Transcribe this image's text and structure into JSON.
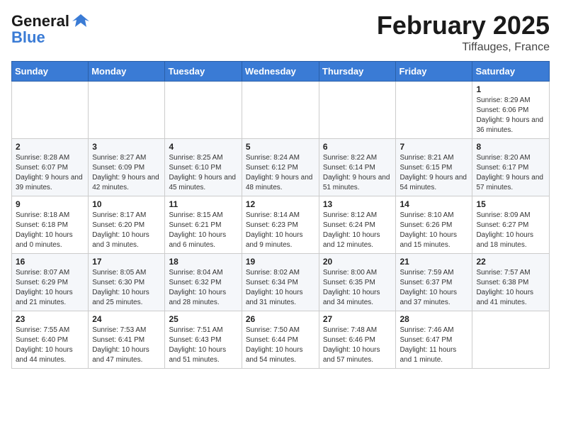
{
  "header": {
    "logo_line1": "General",
    "logo_line2": "Blue",
    "month_year": "February 2025",
    "location": "Tiffauges, France"
  },
  "weekdays": [
    "Sunday",
    "Monday",
    "Tuesday",
    "Wednesday",
    "Thursday",
    "Friday",
    "Saturday"
  ],
  "weeks": [
    [
      {
        "day": "",
        "info": ""
      },
      {
        "day": "",
        "info": ""
      },
      {
        "day": "",
        "info": ""
      },
      {
        "day": "",
        "info": ""
      },
      {
        "day": "",
        "info": ""
      },
      {
        "day": "",
        "info": ""
      },
      {
        "day": "1",
        "info": "Sunrise: 8:29 AM\nSunset: 6:06 PM\nDaylight: 9 hours and 36 minutes."
      }
    ],
    [
      {
        "day": "2",
        "info": "Sunrise: 8:28 AM\nSunset: 6:07 PM\nDaylight: 9 hours and 39 minutes."
      },
      {
        "day": "3",
        "info": "Sunrise: 8:27 AM\nSunset: 6:09 PM\nDaylight: 9 hours and 42 minutes."
      },
      {
        "day": "4",
        "info": "Sunrise: 8:25 AM\nSunset: 6:10 PM\nDaylight: 9 hours and 45 minutes."
      },
      {
        "day": "5",
        "info": "Sunrise: 8:24 AM\nSunset: 6:12 PM\nDaylight: 9 hours and 48 minutes."
      },
      {
        "day": "6",
        "info": "Sunrise: 8:22 AM\nSunset: 6:14 PM\nDaylight: 9 hours and 51 minutes."
      },
      {
        "day": "7",
        "info": "Sunrise: 8:21 AM\nSunset: 6:15 PM\nDaylight: 9 hours and 54 minutes."
      },
      {
        "day": "8",
        "info": "Sunrise: 8:20 AM\nSunset: 6:17 PM\nDaylight: 9 hours and 57 minutes."
      }
    ],
    [
      {
        "day": "9",
        "info": "Sunrise: 8:18 AM\nSunset: 6:18 PM\nDaylight: 10 hours and 0 minutes."
      },
      {
        "day": "10",
        "info": "Sunrise: 8:17 AM\nSunset: 6:20 PM\nDaylight: 10 hours and 3 minutes."
      },
      {
        "day": "11",
        "info": "Sunrise: 8:15 AM\nSunset: 6:21 PM\nDaylight: 10 hours and 6 minutes."
      },
      {
        "day": "12",
        "info": "Sunrise: 8:14 AM\nSunset: 6:23 PM\nDaylight: 10 hours and 9 minutes."
      },
      {
        "day": "13",
        "info": "Sunrise: 8:12 AM\nSunset: 6:24 PM\nDaylight: 10 hours and 12 minutes."
      },
      {
        "day": "14",
        "info": "Sunrise: 8:10 AM\nSunset: 6:26 PM\nDaylight: 10 hours and 15 minutes."
      },
      {
        "day": "15",
        "info": "Sunrise: 8:09 AM\nSunset: 6:27 PM\nDaylight: 10 hours and 18 minutes."
      }
    ],
    [
      {
        "day": "16",
        "info": "Sunrise: 8:07 AM\nSunset: 6:29 PM\nDaylight: 10 hours and 21 minutes."
      },
      {
        "day": "17",
        "info": "Sunrise: 8:05 AM\nSunset: 6:30 PM\nDaylight: 10 hours and 25 minutes."
      },
      {
        "day": "18",
        "info": "Sunrise: 8:04 AM\nSunset: 6:32 PM\nDaylight: 10 hours and 28 minutes."
      },
      {
        "day": "19",
        "info": "Sunrise: 8:02 AM\nSunset: 6:34 PM\nDaylight: 10 hours and 31 minutes."
      },
      {
        "day": "20",
        "info": "Sunrise: 8:00 AM\nSunset: 6:35 PM\nDaylight: 10 hours and 34 minutes."
      },
      {
        "day": "21",
        "info": "Sunrise: 7:59 AM\nSunset: 6:37 PM\nDaylight: 10 hours and 37 minutes."
      },
      {
        "day": "22",
        "info": "Sunrise: 7:57 AM\nSunset: 6:38 PM\nDaylight: 10 hours and 41 minutes."
      }
    ],
    [
      {
        "day": "23",
        "info": "Sunrise: 7:55 AM\nSunset: 6:40 PM\nDaylight: 10 hours and 44 minutes."
      },
      {
        "day": "24",
        "info": "Sunrise: 7:53 AM\nSunset: 6:41 PM\nDaylight: 10 hours and 47 minutes."
      },
      {
        "day": "25",
        "info": "Sunrise: 7:51 AM\nSunset: 6:43 PM\nDaylight: 10 hours and 51 minutes."
      },
      {
        "day": "26",
        "info": "Sunrise: 7:50 AM\nSunset: 6:44 PM\nDaylight: 10 hours and 54 minutes."
      },
      {
        "day": "27",
        "info": "Sunrise: 7:48 AM\nSunset: 6:46 PM\nDaylight: 10 hours and 57 minutes."
      },
      {
        "day": "28",
        "info": "Sunrise: 7:46 AM\nSunset: 6:47 PM\nDaylight: 11 hours and 1 minute."
      },
      {
        "day": "",
        "info": ""
      }
    ]
  ]
}
